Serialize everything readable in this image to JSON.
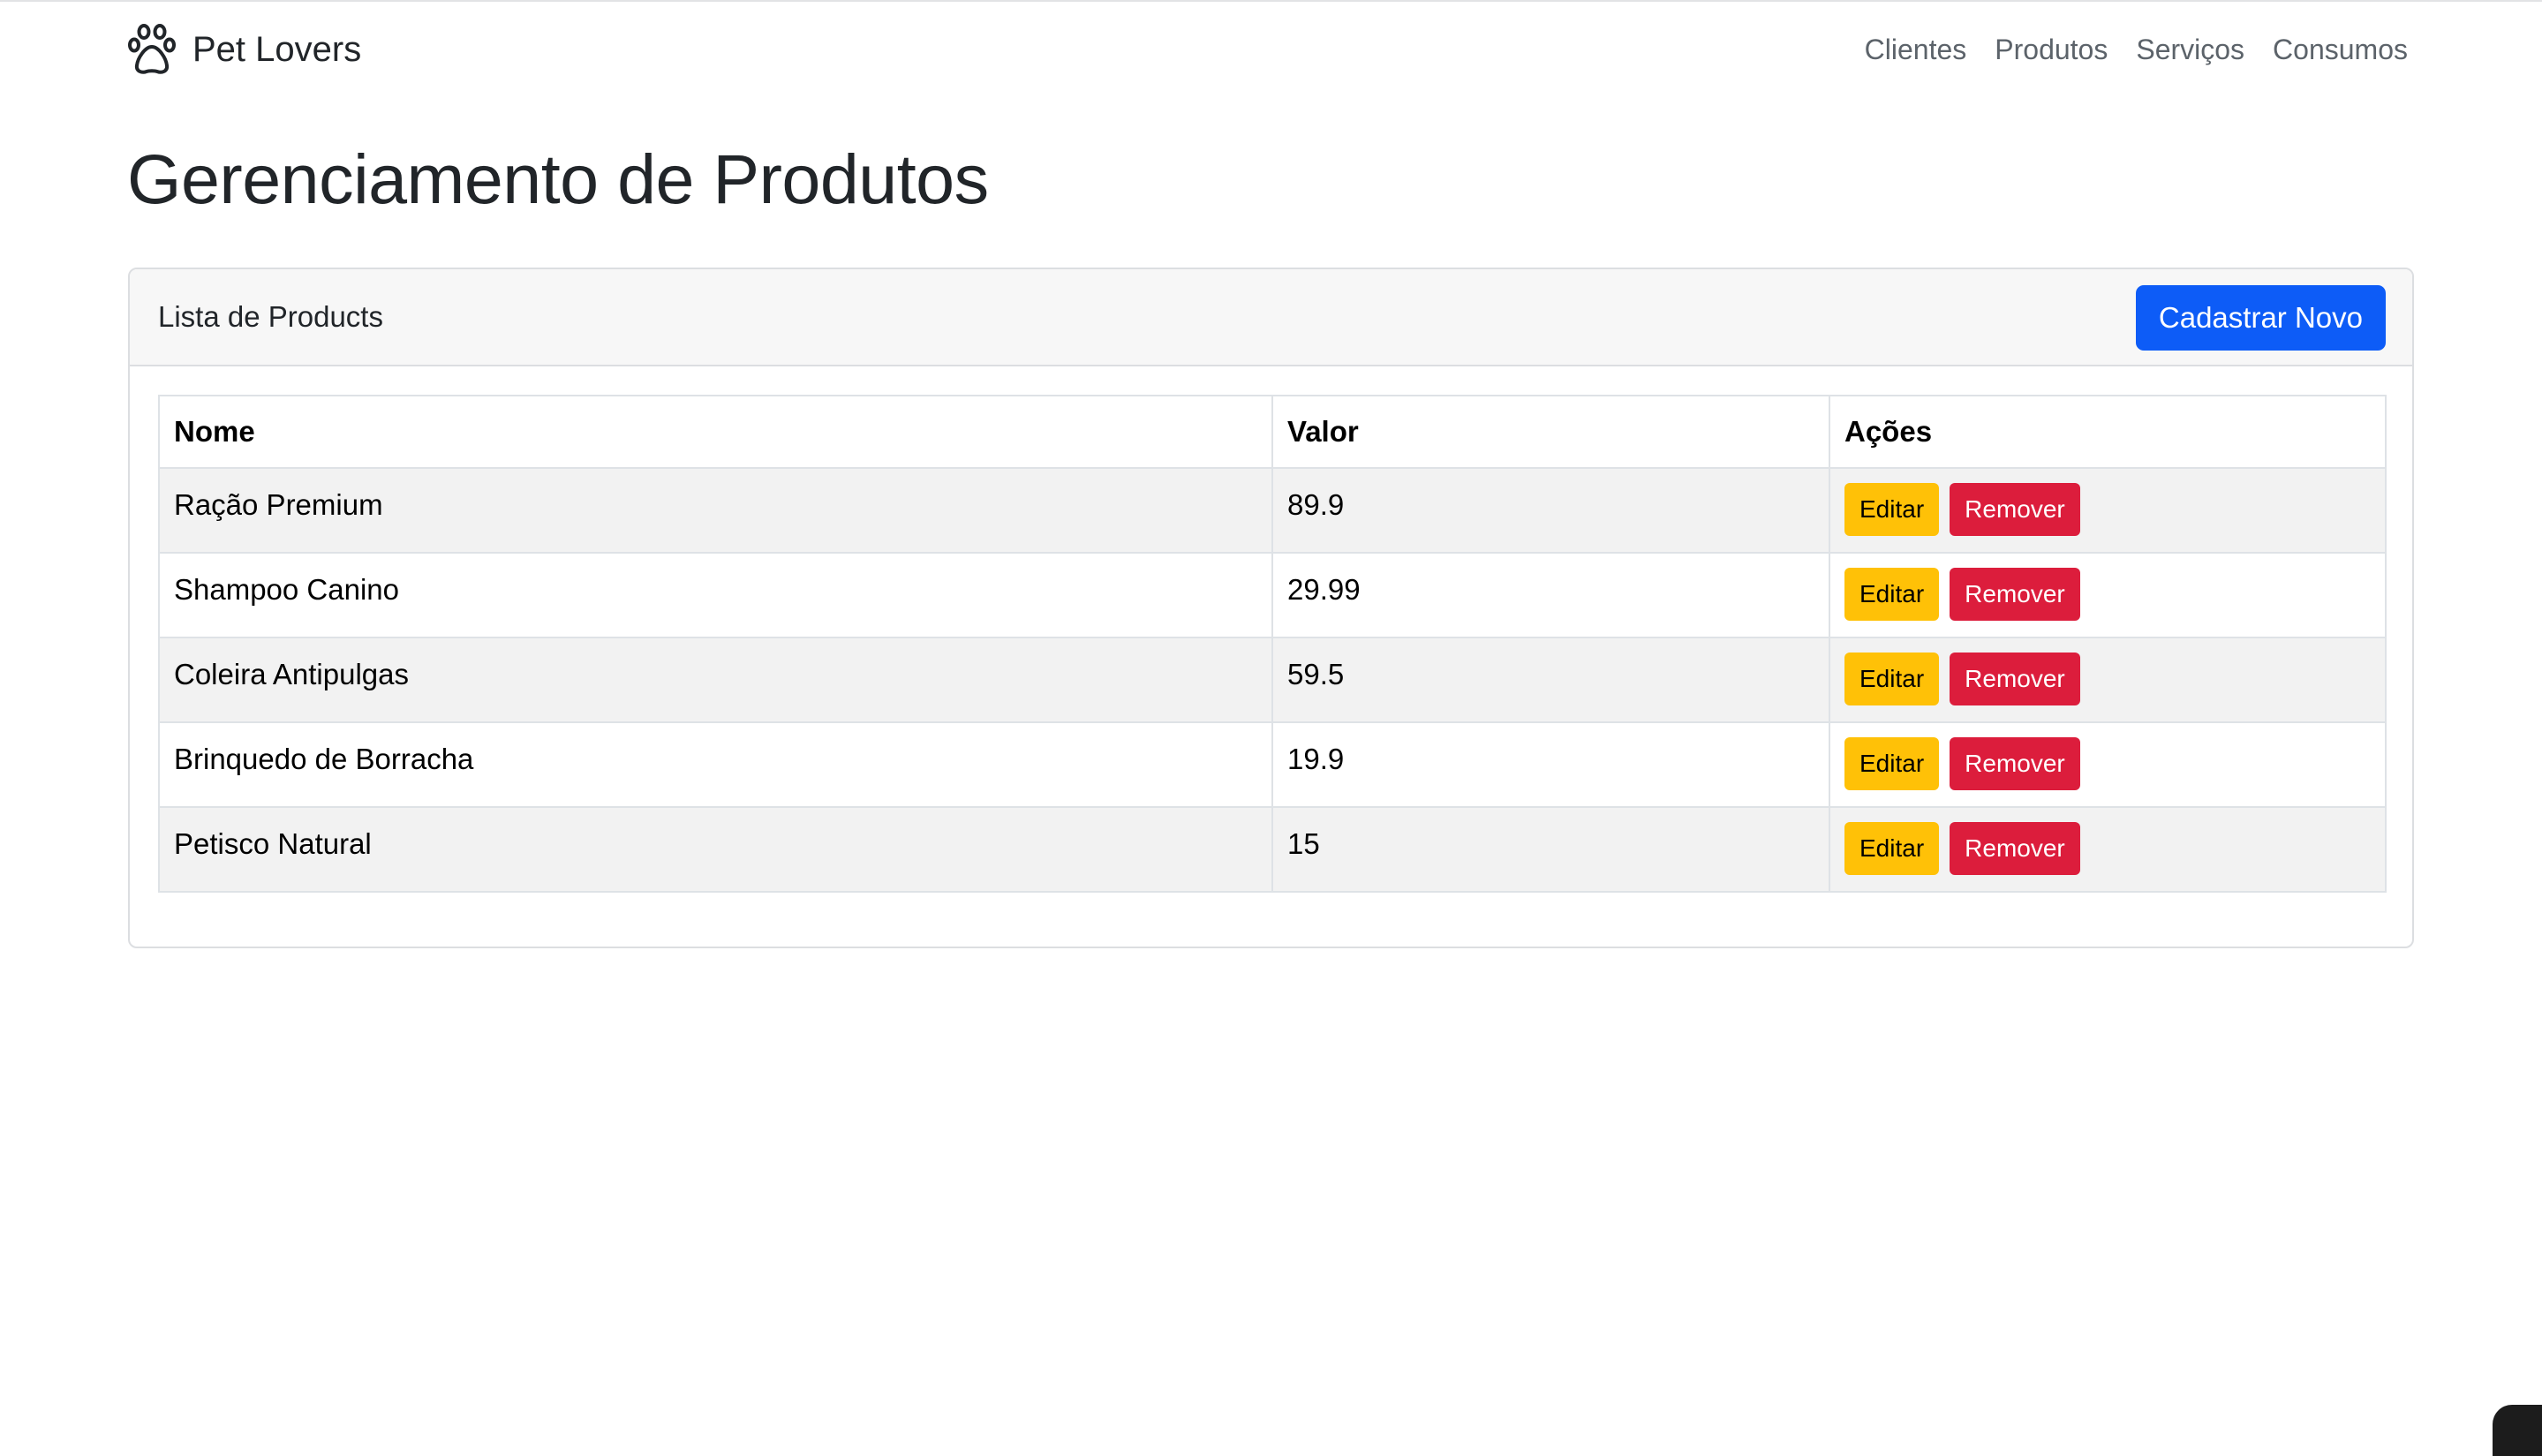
{
  "navbar": {
    "brand_icon": "paw-icon",
    "brand": "Pet Lovers",
    "links": [
      "Clientes",
      "Produtos",
      "Serviços",
      "Consumos"
    ]
  },
  "page": {
    "title": "Gerenciamento de Produtos"
  },
  "card": {
    "header_title": "Lista de Products",
    "new_button": "Cadastrar Novo"
  },
  "table": {
    "columns": [
      "Nome",
      "Valor",
      "Ações"
    ],
    "rows": [
      {
        "nome": "Ração Premium",
        "valor": "89.9"
      },
      {
        "nome": "Shampoo Canino",
        "valor": "29.99"
      },
      {
        "nome": "Coleira Antipulgas",
        "valor": "59.5"
      },
      {
        "nome": "Brinquedo de Borracha",
        "valor": "19.9"
      },
      {
        "nome": "Petisco Natural",
        "valor": "15"
      }
    ],
    "edit_label": "Editar",
    "remove_label": "Remover"
  },
  "colors": {
    "primary": "#0d5cf7",
    "warning": "#ffc107",
    "danger": "#dc1d3c"
  }
}
